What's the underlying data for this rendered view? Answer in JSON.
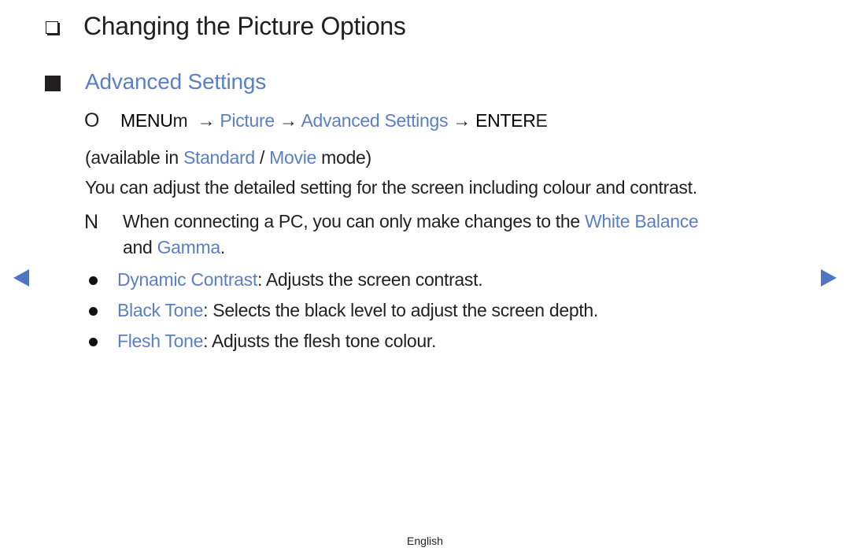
{
  "page": {
    "title": "Changing the Picture Options",
    "section_title": "Advanced Settings",
    "menu_path": {
      "icon_glyph": "O",
      "menu_key": "MENU",
      "menu_key_suffix": "m",
      "arrow": "→",
      "step1": "Picture",
      "step2": "Advanced Settings",
      "enter_key": "ENTER",
      "enter_key_suffix": "E"
    },
    "availability": {
      "prefix": "(available in ",
      "mode1": "Standard",
      "separator": " / ",
      "mode2": "Movie",
      "suffix": " mode)"
    },
    "description": "You can adjust the detailed setting for the screen including colour and contrast.",
    "note": {
      "icon_glyph": "N",
      "line1_text": "When connecting a PC, you can only make changes to the ",
      "line1_link": "White Balance",
      "line2_prefix": "and ",
      "line2_link": "Gamma",
      "line2_suffix": "."
    },
    "items": [
      {
        "term": "Dynamic Contrast",
        "text": ": Adjusts the screen contrast."
      },
      {
        "term": "Black Tone",
        "text": ": Selects the black level to adjust the screen depth."
      },
      {
        "term": "Flesh Tone",
        "text": ": Adjusts the flesh tone colour."
      }
    ],
    "footer": "English"
  },
  "navigation": {
    "prev_icon": "triangle-left",
    "next_icon": "triangle-right"
  },
  "colors": {
    "accent": "#5a7fc4",
    "nav_arrow": "#4f76c1",
    "text": "#231f20"
  }
}
